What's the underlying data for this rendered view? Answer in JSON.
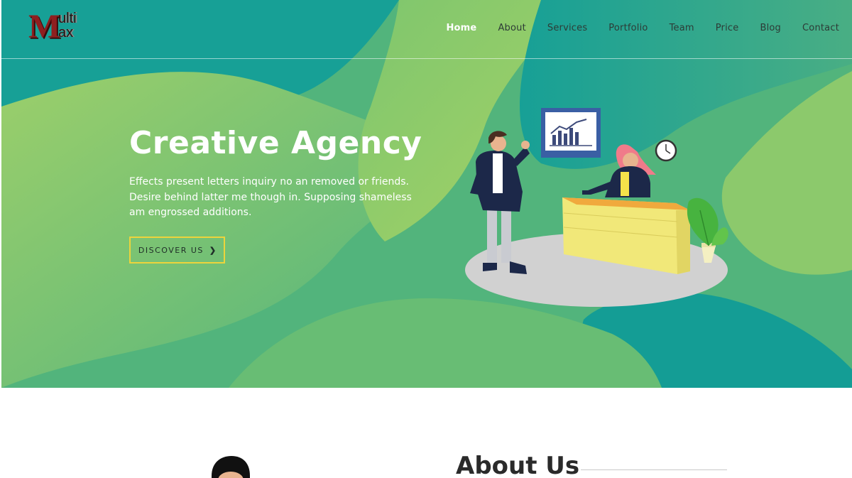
{
  "logo": {
    "letter_m": "M",
    "ulti": "ulti",
    "ax": "ax"
  },
  "nav": {
    "items": [
      {
        "label": "Home",
        "active": true
      },
      {
        "label": "About",
        "active": false
      },
      {
        "label": "Services",
        "active": false
      },
      {
        "label": "Portfolio",
        "active": false
      },
      {
        "label": "Team",
        "active": false
      },
      {
        "label": "Price",
        "active": false
      },
      {
        "label": "Blog",
        "active": false
      },
      {
        "label": "Contact",
        "active": false
      }
    ]
  },
  "hero": {
    "title": "Creative Agency",
    "text": "Effects present letters inquiry no an removed or friends. Desire behind latter me though in. Supposing shameless am engrossed additions.",
    "cta_label": "DISCOVER US",
    "cta_icon": "chevron-right-icon",
    "illustration": "office-reception-illustration"
  },
  "about": {
    "title": "About Us"
  },
  "colors": {
    "hero_teal": "#139a96",
    "hero_green": "#8cc96c",
    "cta_border": "#ecd43c",
    "nav_active": "#ffffff",
    "logo_red": "#8e1f1f"
  }
}
